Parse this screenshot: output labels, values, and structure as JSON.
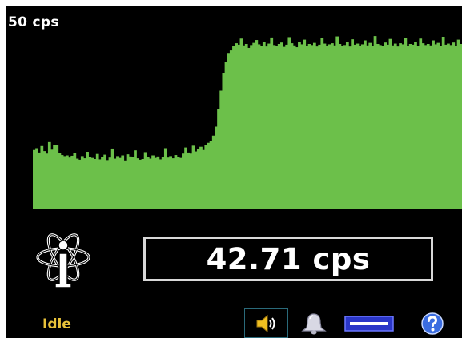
{
  "scale_label": "50 cps",
  "readout": {
    "value": "42.71 cps"
  },
  "status": {
    "text": "Idle",
    "color": "#e8c23a"
  },
  "colors": {
    "background": "#000000",
    "histogram": "#6cc04a",
    "readout_border": "#d8d8d8",
    "text": "#ffffff"
  },
  "icons": [
    "atom-logo-icon",
    "speaker-icon",
    "bell-icon",
    "level-bar-icon",
    "help-icon"
  ],
  "chart_data": {
    "type": "area",
    "ylim": [
      0,
      50
    ],
    "values": [
      16.5,
      17.0,
      15.8,
      17.6,
      16.2,
      15.5,
      18.7,
      16.6,
      18.0,
      17.8,
      15.6,
      15.1,
      14.8,
      15.0,
      14.4,
      14.9,
      15.7,
      14.1,
      13.8,
      14.8,
      14.2,
      16.0,
      14.5,
      14.3,
      14.0,
      15.4,
      13.9,
      14.6,
      15.2,
      13.7,
      14.4,
      16.9,
      14.1,
      14.8,
      14.3,
      15.0,
      13.6,
      15.3,
      14.7,
      14.5,
      16.4,
      14.2,
      13.8,
      14.0,
      15.9,
      14.6,
      14.1,
      15.0,
      14.3,
      14.7,
      13.9,
      14.5,
      17.0,
      14.4,
      14.8,
      14.2,
      15.1,
      14.6,
      14.3,
      15.5,
      17.2,
      15.8,
      15.5,
      17.7,
      16.1,
      16.8,
      17.4,
      16.5,
      17.9,
      18.5,
      19.0,
      20.5,
      23.0,
      28.0,
      33.0,
      38.0,
      41.0,
      43.5,
      44.2,
      45.5,
      46.2,
      45.8,
      47.5,
      45.6,
      46.0,
      44.9,
      45.7,
      46.3,
      47.1,
      45.9,
      45.4,
      46.6,
      45.3,
      46.1,
      47.8,
      45.7,
      45.5,
      46.0,
      46.4,
      45.2,
      45.8,
      47.9,
      46.2,
      45.6,
      45.1,
      46.5,
      45.9,
      47.2,
      45.4,
      46.0,
      45.7,
      46.3,
      45.3,
      45.8,
      47.6,
      46.1,
      45.5,
      45.9,
      46.2,
      45.6,
      48.1,
      46.0,
      45.4,
      45.7,
      46.6,
      45.3,
      47.3,
      45.8,
      46.1,
      45.5,
      45.9,
      47.0,
      45.6,
      46.3,
      45.4,
      48.2,
      46.0,
      45.7,
      45.5,
      46.4,
      45.8,
      47.4,
      45.6,
      46.1,
      45.3,
      46.2,
      45.9,
      47.7,
      45.5,
      46.0,
      45.8,
      46.5,
      45.4,
      47.5,
      46.2,
      45.7,
      46.0,
      45.6,
      47.0,
      45.9,
      46.3,
      45.5,
      48.0,
      45.8,
      46.1,
      45.7,
      46.4,
      45.4,
      47.2,
      46.0
    ]
  }
}
